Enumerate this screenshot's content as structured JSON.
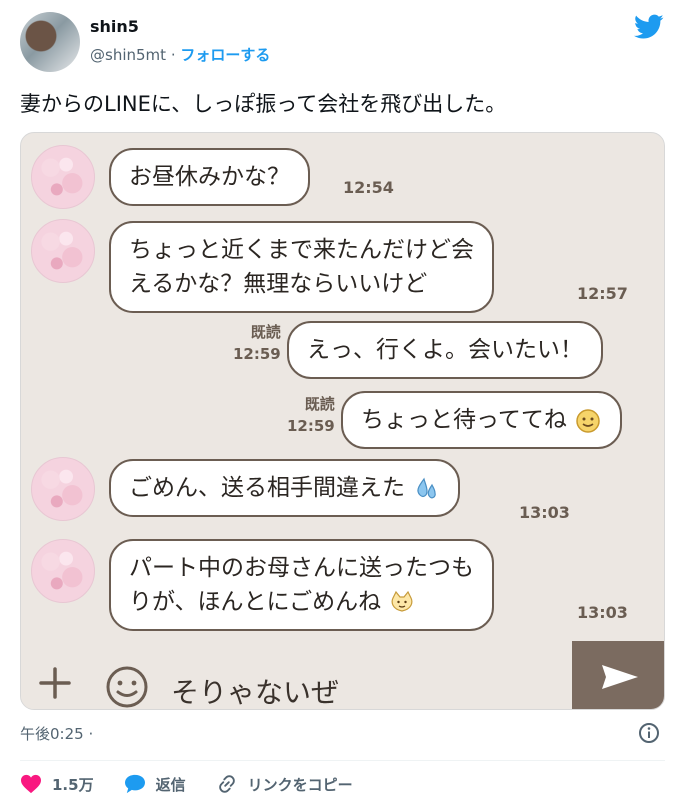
{
  "tweet": {
    "author_name": "shin5",
    "handle": "@shin5mt",
    "separator": "·",
    "follow_label": "フォローする",
    "text": "妻からのLINEに、しっぽ振って会社を飛び出した。",
    "timestamp": "午後0:25 ·"
  },
  "chat": {
    "messages": [
      {
        "side": "incoming",
        "lines": [
          "お昼休みかな？"
        ],
        "time": "12:54"
      },
      {
        "side": "incoming",
        "lines": [
          "ちょっと近くまで来たんだけど会",
          "えるかな？無理ならいいけど"
        ],
        "time": "12:57"
      },
      {
        "side": "outgoing",
        "lines": [
          "えっ、行くよ。会いたい！"
        ],
        "read": "既読",
        "time": "12:59"
      },
      {
        "side": "outgoing",
        "lines": [
          "ちょっと待っててね"
        ],
        "read": "既読",
        "time": "12:59",
        "emoji": "smile-emoji"
      },
      {
        "side": "incoming",
        "lines": [
          "ごめん、送る相手間違えた"
        ],
        "time": "13:03",
        "emoji": "sweat-drop-emoji"
      },
      {
        "side": "incoming",
        "lines": [
          "パート中のお母さんに送ったつも",
          "りが、ほんとにごめんね"
        ],
        "time": "13:03",
        "emoji": "cat-emoji"
      }
    ],
    "input_text": "そりゃないぜ",
    "colors": {
      "background": "#ece7e2",
      "bubble_border": "#6b5d52",
      "send_button": "#7b6b60"
    }
  },
  "actions": {
    "likes": "1.5万",
    "reply": "返信",
    "copy_link": "リンクをコピー"
  },
  "colors": {
    "accent": "#1d9bf0",
    "like": "#f91880"
  }
}
